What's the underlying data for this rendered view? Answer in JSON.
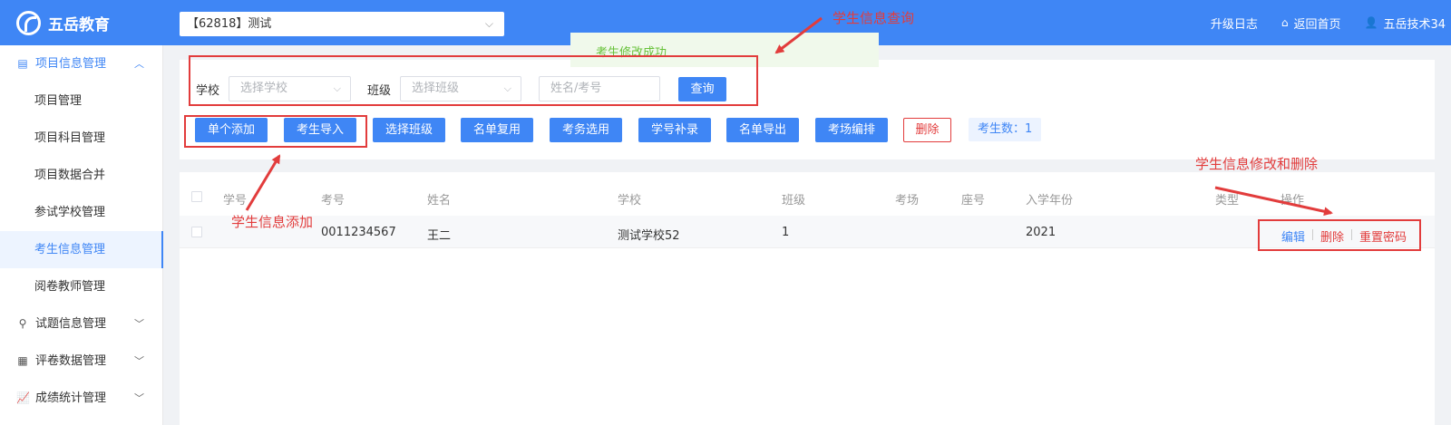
{
  "header": {
    "logo_text": "五岳教育",
    "project_select": "【62818】测试",
    "upgrade_log": "升级日志",
    "home": "返回首页",
    "user": "五岳技术34"
  },
  "sidebar": {
    "groups": [
      {
        "label": "项目信息管理",
        "icon": "database-icon",
        "state": "expanded"
      },
      {
        "label": "试题信息管理",
        "icon": "user-icon",
        "state": "collapsed"
      },
      {
        "label": "评卷数据管理",
        "icon": "list-icon",
        "state": "collapsed"
      },
      {
        "label": "成绩统计管理",
        "icon": "chart-icon",
        "state": "collapsed"
      }
    ],
    "items": [
      {
        "label": "项目管理"
      },
      {
        "label": "项目科目管理"
      },
      {
        "label": "项目数据合并"
      },
      {
        "label": "参试学校管理"
      },
      {
        "label": "考生信息管理",
        "active": true
      },
      {
        "label": "阅卷教师管理"
      }
    ]
  },
  "toast": "考生修改成功",
  "filters": {
    "school_label": "学校",
    "school_placeholder": "选择学校",
    "class_label": "班级",
    "class_placeholder": "选择班级",
    "name_placeholder": "姓名/考号",
    "query_button": "查询"
  },
  "actions": {
    "add_single": "单个添加",
    "import": "考生导入",
    "select_class": "选择班级",
    "reuse_list": "名单复用",
    "exam_select": "考务选用",
    "student_no_fill": "学号补录",
    "export_list": "名单导出",
    "room_arrange": "考场编排",
    "delete": "删除",
    "count": "考生数：1"
  },
  "table": {
    "headers": [
      "学号",
      "考号",
      "姓名",
      "学校",
      "班级",
      "考场",
      "座号",
      "入学年份",
      "类型",
      "操作"
    ],
    "rows": [
      {
        "student_no": "",
        "exam_no": "0011234567",
        "name": "王二",
        "school": "测试学校52",
        "class": "1",
        "room": "",
        "seat": "",
        "year": "2021",
        "type": ""
      }
    ],
    "ops": {
      "edit": "编辑",
      "delete": "删除",
      "reset": "重置密码"
    }
  },
  "annotations": {
    "query": "学生信息查询",
    "add": "学生信息添加",
    "modify": "学生信息修改和删除"
  },
  "colors": {
    "accent": "#3f86f5",
    "annotation": "#e23c3c",
    "success": "#67c23a"
  }
}
